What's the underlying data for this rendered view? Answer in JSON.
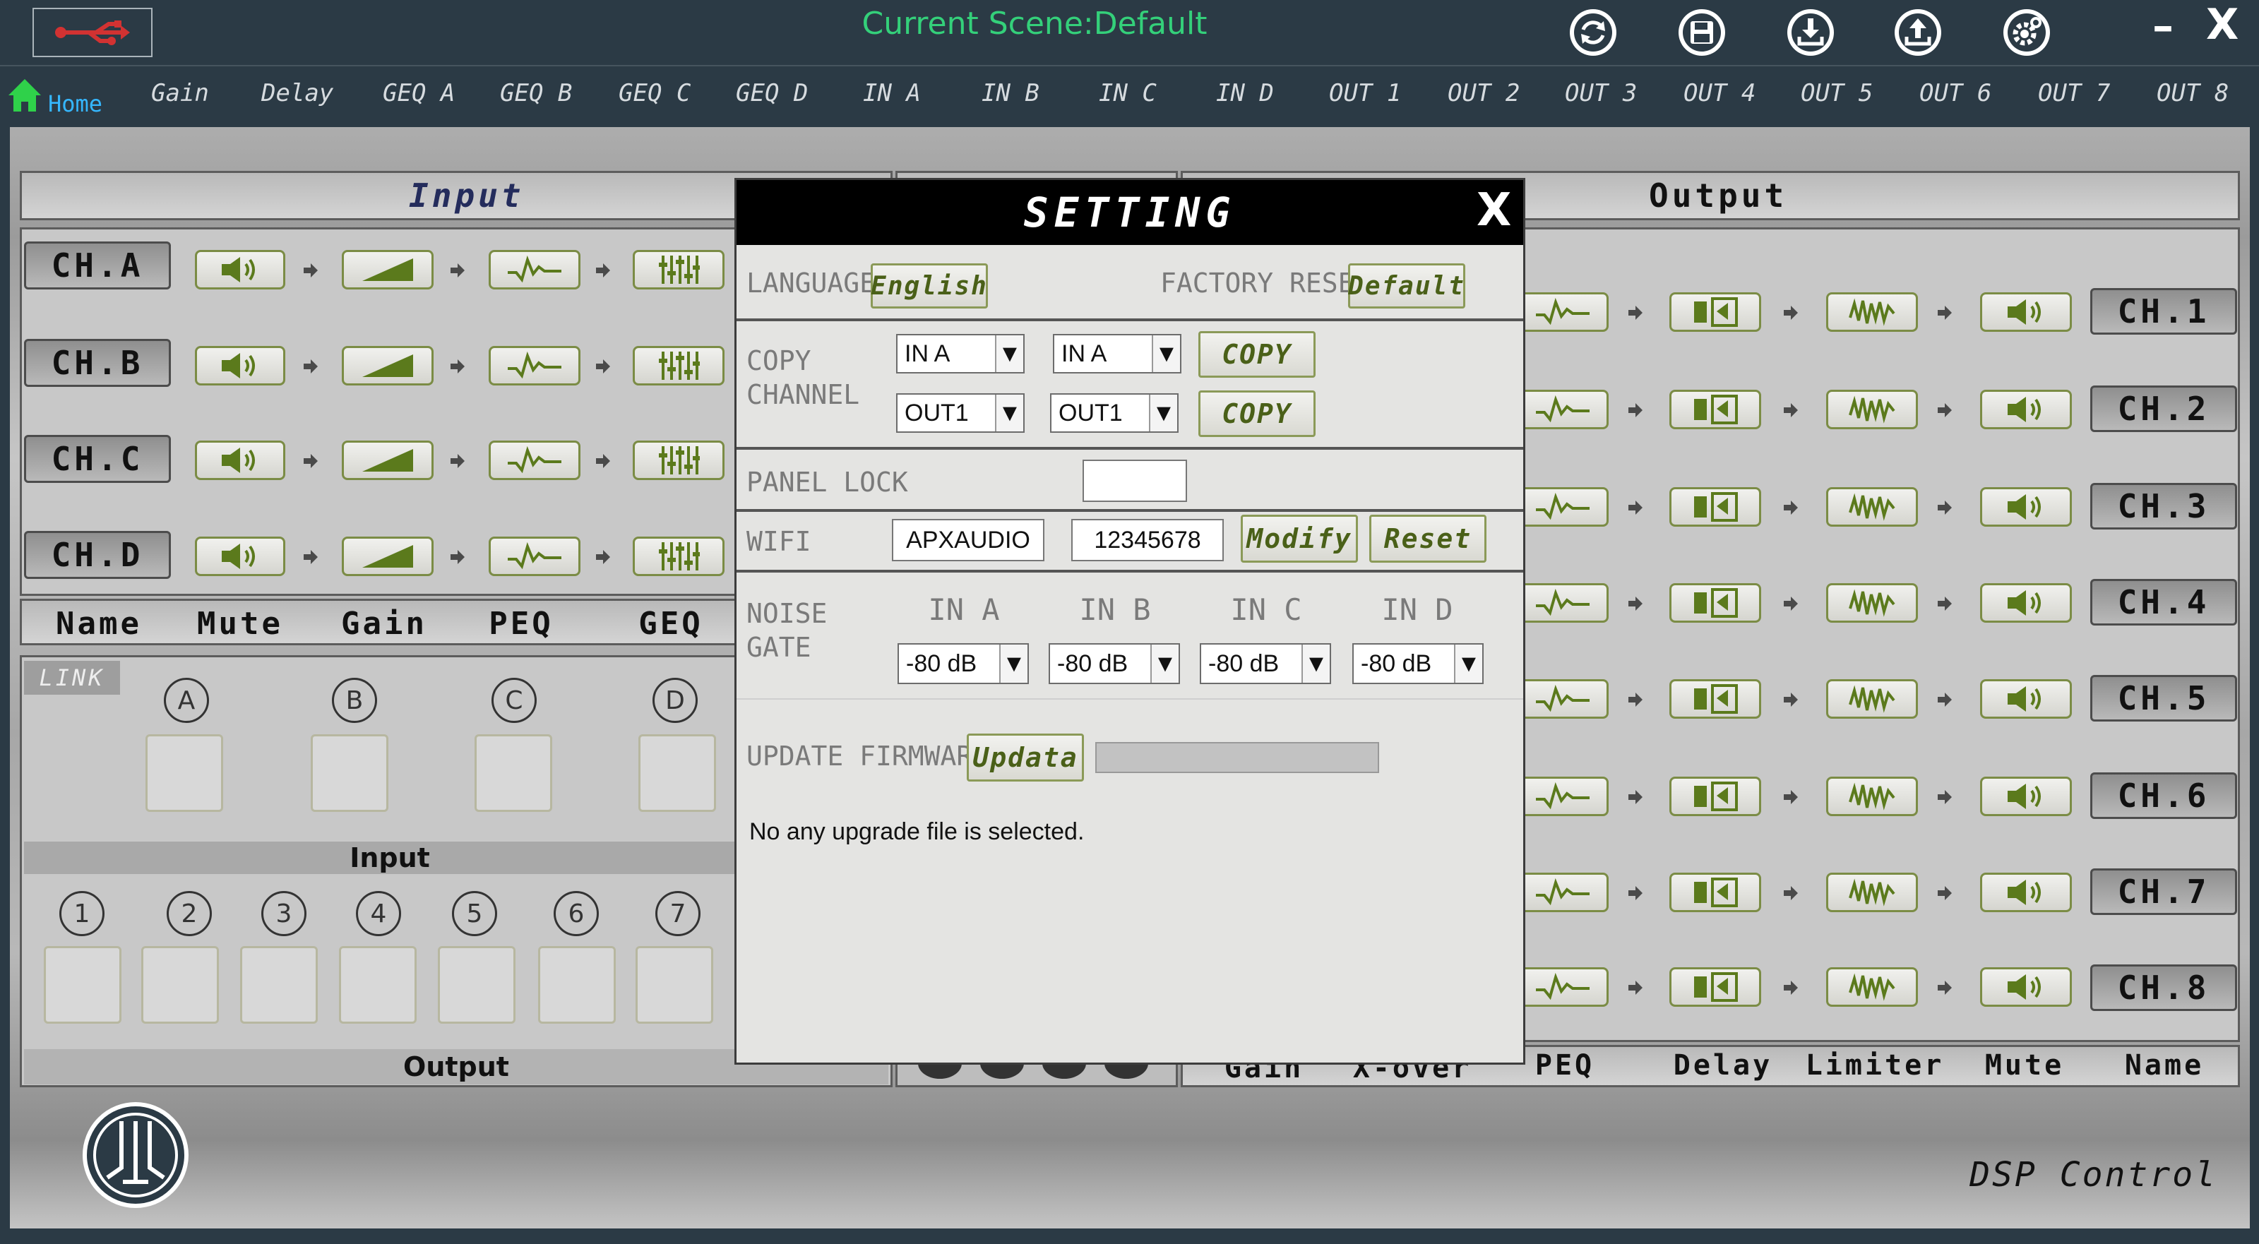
{
  "title": "Current Scene:Default",
  "window_controls": {
    "minimize": "–",
    "close": "X"
  },
  "nav": [
    "Home",
    "Gain",
    "Delay",
    "GEQ A",
    "GEQ B",
    "GEQ C",
    "GEQ D",
    "IN A",
    "IN B",
    "IN C",
    "IN D",
    "OUT 1",
    "OUT 2",
    "OUT 3",
    "OUT 4",
    "OUT 5",
    "OUT 6",
    "OUT 7",
    "OUT 8"
  ],
  "input_panel": {
    "header": "Input",
    "channels": [
      "CH.A",
      "CH.B",
      "CH.C",
      "CH.D"
    ],
    "columns": [
      "Name",
      "Mute",
      "Gain",
      "PEQ",
      "GEQ"
    ]
  },
  "link_panel": {
    "label": "LINK",
    "letters": [
      "A",
      "B",
      "C",
      "D"
    ],
    "input_label": "Input",
    "numbers": [
      "1",
      "2",
      "3",
      "4",
      "5",
      "6",
      "7"
    ],
    "output_label": "Output"
  },
  "output_panel": {
    "header": "Output",
    "channels": [
      "CH.1",
      "CH.2",
      "CH.3",
      "CH.4",
      "CH.5",
      "CH.6",
      "CH.7",
      "CH.8"
    ],
    "columns": [
      "Gain",
      "X-over",
      "PEQ",
      "Delay",
      "Limiter",
      "Mute",
      "Name"
    ]
  },
  "bottom_label": "DSP Control",
  "setting": {
    "title": "SETTING",
    "close": "X",
    "language_label": "LANGUAGE",
    "language_value": "English",
    "factory_reset_label": "FACTORY RESET",
    "factory_reset_button": "Default",
    "copy_label_1": "COPY",
    "copy_label_2": "CHANNEL",
    "copy_in_from": "IN A",
    "copy_in_to": "IN A",
    "copy_out_from": "OUT1",
    "copy_out_to": "OUT1",
    "copy_button": "COPY",
    "panel_lock_label": "PANEL  LOCK",
    "wifi_label": "WIFI",
    "wifi_name": "APXAUDIO",
    "wifi_password": "12345678",
    "modify_button": "Modify",
    "reset_button": "Reset",
    "noise_label_1": "NOISE",
    "noise_label_2": "GATE",
    "noise_inputs": [
      "IN A",
      "IN B",
      "IN C",
      "IN D"
    ],
    "noise_values": [
      "-80 dB",
      "-80 dB",
      "-80 dB",
      "-80 dB"
    ],
    "firmware_label": "UPDATE FIRMWARE",
    "firmware_button": "Updata",
    "firmware_progress": 0,
    "status": "No any upgrade file is selected."
  }
}
